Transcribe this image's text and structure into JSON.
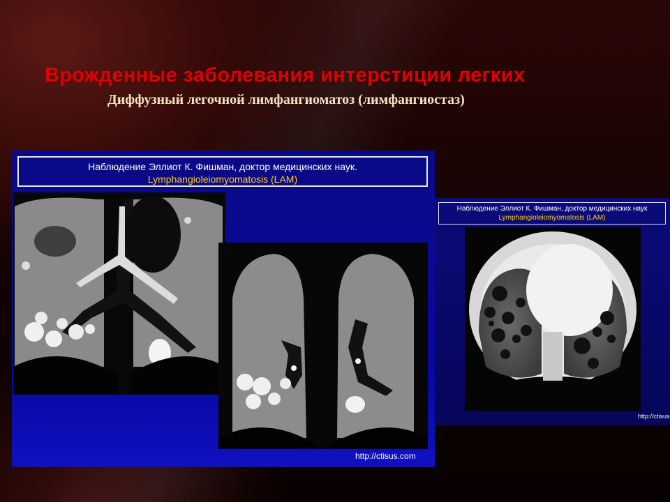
{
  "slide": {
    "title": "Врожденные заболевания интерстиции легких",
    "subtitle": "Диффузный легочной лимфангиоматоз (лимфангиостаз)"
  },
  "image_front": {
    "caption_line1": "Наблюдение Эллиот К. Фишман, доктор медицинских наук.",
    "caption_line2": "Lymphangioleiomyomatosis (LAM)",
    "source_url": "http://ctisus.com"
  },
  "image_back": {
    "caption_line1": "Наблюдение Эллиот К. Фишман, доктор медицинских наук",
    "caption_line2": "Lymphangioleiomyomatosis (LAM)",
    "source_url": "http://ctisus."
  },
  "colors": {
    "title": "#e00000",
    "subtitle": "#f4e3c3",
    "panel_blue": "#0808a0",
    "caption_highlight": "#ffd000"
  }
}
